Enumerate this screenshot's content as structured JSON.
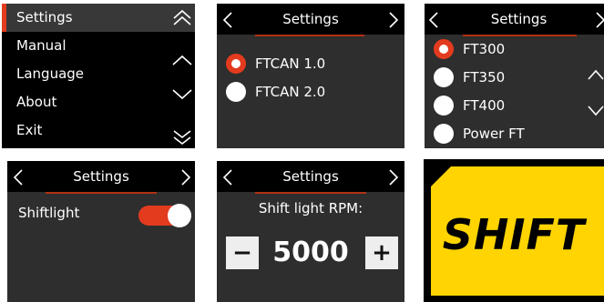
{
  "menu": {
    "items": [
      {
        "label": "Settings",
        "selected": true
      },
      {
        "label": "Manual",
        "selected": false
      },
      {
        "label": "Language",
        "selected": false
      },
      {
        "label": "About",
        "selected": false
      },
      {
        "label": "Exit",
        "selected": false
      }
    ]
  },
  "can_screen": {
    "title": "Settings",
    "options": [
      {
        "label": "FTCAN 1.0",
        "selected": true
      },
      {
        "label": "FTCAN 2.0",
        "selected": false
      }
    ]
  },
  "ecu_screen": {
    "title": "Settings",
    "options": [
      {
        "label": "FT300",
        "selected": true
      },
      {
        "label": "FT350",
        "selected": false
      },
      {
        "label": "FT400",
        "selected": false
      },
      {
        "label": "Power FT",
        "selected": false
      }
    ]
  },
  "shiftlight_screen": {
    "title": "Settings",
    "label": "Shiftlight",
    "enabled": true
  },
  "rpm_screen": {
    "title": "Settings",
    "label": "Shift light RPM:",
    "value": "5000",
    "minus": "−",
    "plus": "+"
  },
  "shift_screen": {
    "text": "SHIFT"
  },
  "colors": {
    "accent": "#e33b1e",
    "shift_yellow": "#ffd400"
  }
}
